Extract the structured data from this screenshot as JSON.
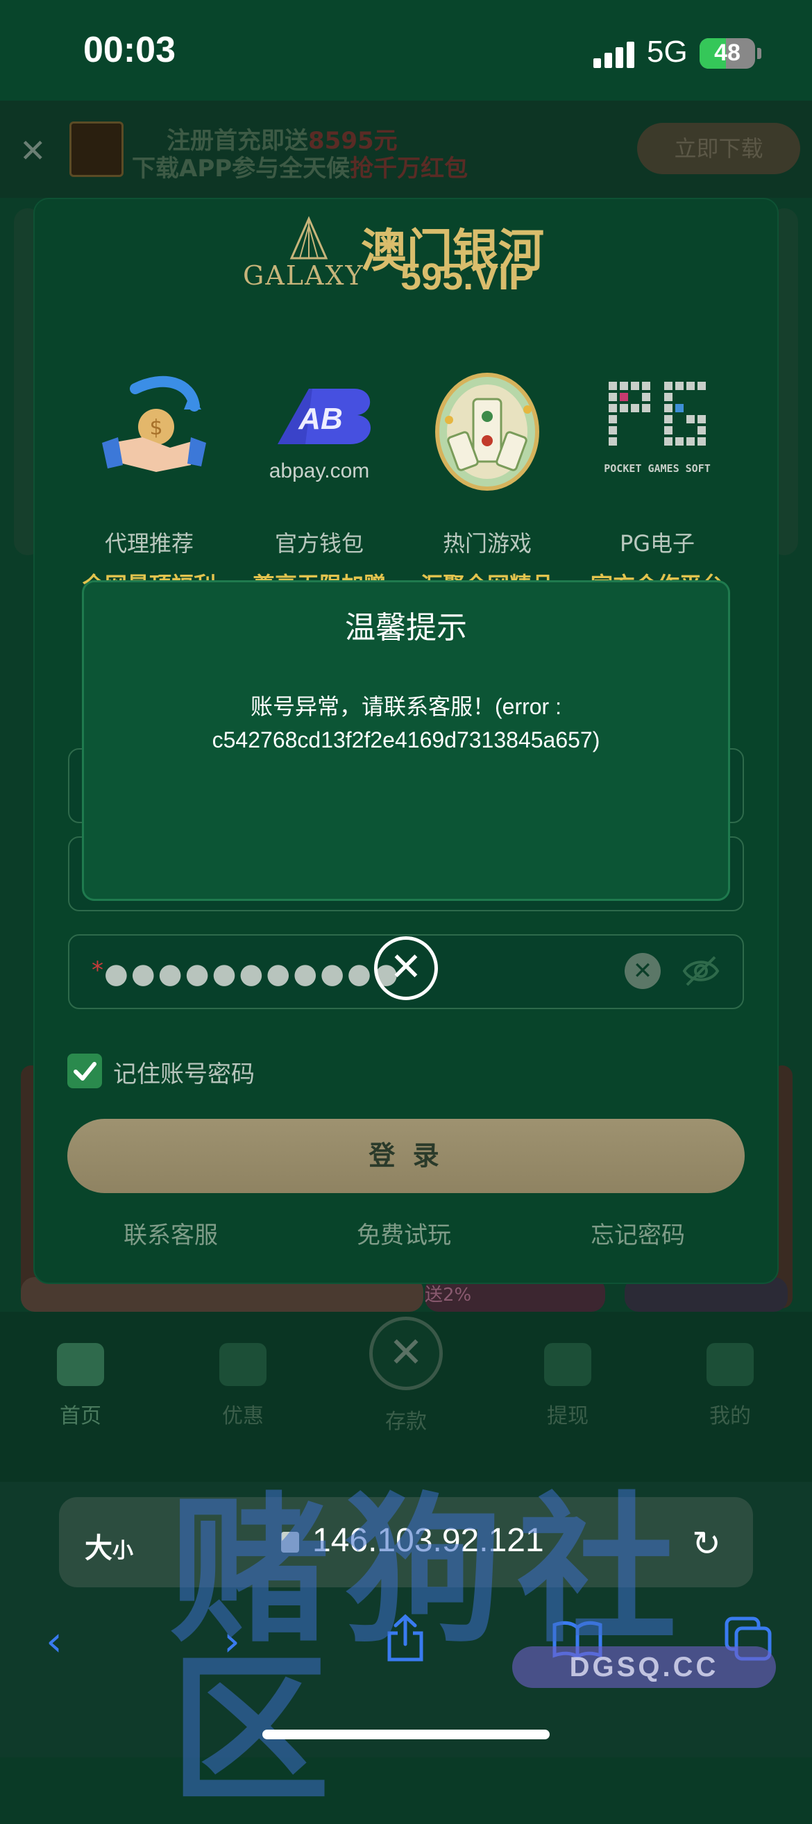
{
  "status_bar": {
    "time": "00:03",
    "network": "5G",
    "battery": "48",
    "battery_level": 0.48
  },
  "promo": {
    "line1_prefix": "注册首充即送",
    "line1_amount": "8595元",
    "line2_prefix": "下载APP参与全天候",
    "line2_highlight": "抢千万红包",
    "download_label": "立即下载"
  },
  "brand": {
    "galaxy": "GALAXY",
    "name_cn": "澳门银河",
    "domain": "595.VIP"
  },
  "features": [
    {
      "icon": "handshake-icon",
      "title": "代理推荐",
      "subtitle": "全网最顶福利"
    },
    {
      "icon": "abpay-logo",
      "logo_text": "abpay.com",
      "title": "官方钱包",
      "subtitle": "尊享无限加赠"
    },
    {
      "icon": "mahjong-icon",
      "title": "热门游戏",
      "subtitle": "汇聚全网精品"
    },
    {
      "icon": "pg-logo",
      "logo_text": "POCKET GAMES SOFT",
      "title": "PG电子",
      "subtitle": "官方合作平台"
    }
  ],
  "dialog": {
    "title": "温馨提示",
    "message_line1": "账号异常，请联系客服！(error :",
    "message_line2": "c542768cd13f2f2e4169d7313845a657)"
  },
  "login_form": {
    "password_required_mark": "*",
    "password_value": "●●●●●●●●●●●",
    "remember_label": "记住账号密码",
    "remember_checked": true,
    "login_label": "登 录",
    "links": [
      "联系客服",
      "免费试玩",
      "忘记密码"
    ]
  },
  "bottom_nav": {
    "items": [
      {
        "label": "首页",
        "icon": "home-icon"
      },
      {
        "label": "优惠",
        "icon": "gift-icon"
      },
      {
        "label": "存款",
        "icon": "deposit-icon"
      },
      {
        "label": "提现",
        "icon": "withdraw-icon"
      },
      {
        "label": "我的",
        "icon": "profile-icon"
      }
    ],
    "promo_tag": "送2%"
  },
  "browser": {
    "size_label": "大",
    "size_label_small": "小",
    "url": "146.103.92.121"
  },
  "watermark": {
    "text": "赌狗社区",
    "url": "DGSQ.CC"
  },
  "colors": {
    "modal_bg": "#08442a",
    "dialog_bg": "#0c5535",
    "accent_gold": "#e2c34e",
    "ios_blue": "#3a7bf0"
  }
}
